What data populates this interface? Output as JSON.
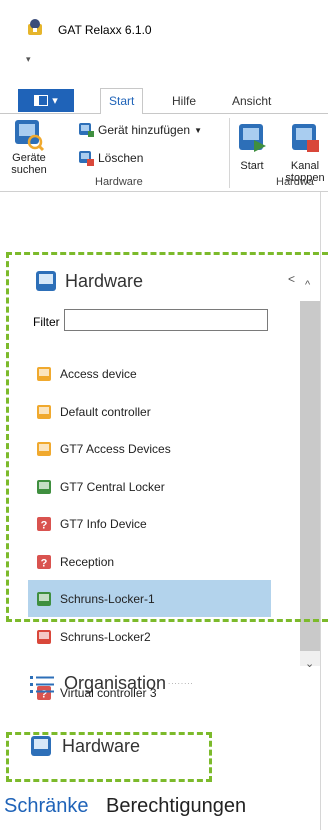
{
  "window": {
    "title": "GAT Relaxx 6.1.0",
    "qat_glyph": "▾"
  },
  "ribbon_tabs": {
    "file_menu_glyph": "▾",
    "tabs": [
      {
        "label": "Start",
        "active": true
      },
      {
        "label": "Hilfe",
        "active": false
      },
      {
        "label": "Ansicht",
        "active": false
      }
    ]
  },
  "ribbon": {
    "geraete_suchen": "Geräte suchen",
    "geraet_hinzufuegen": "Gerät hinzufügen",
    "loeschen": "Löschen",
    "group_hardware": "Hardware",
    "start": "Start",
    "kanal_stoppen": "Kanal stoppen",
    "group_hardware2": "Hardwa"
  },
  "panel": {
    "title": "Hardware",
    "filter_label": "Filter",
    "filter_value": "",
    "items": [
      {
        "label": "Access device",
        "icon": "device-orange-icon",
        "color": "#f0a92e",
        "selected": false
      },
      {
        "label": "Default controller",
        "icon": "device-orange-icon",
        "color": "#f0a92e",
        "selected": false
      },
      {
        "label": "GT7 Access Devices",
        "icon": "device-orange-icon",
        "color": "#f0a92e",
        "selected": false
      },
      {
        "label": "GT7 Central Locker",
        "icon": "device-green-icon",
        "color": "#3f8f3f",
        "selected": false
      },
      {
        "label": "GT7 Info Device",
        "icon": "device-unknown-icon",
        "color": "#d9534f",
        "selected": false
      },
      {
        "label": "Reception",
        "icon": "device-unknown-icon",
        "color": "#d9534f",
        "selected": false
      },
      {
        "label": "Schruns-Locker-1",
        "icon": "device-green-icon",
        "color": "#3f8f3f",
        "selected": true
      },
      {
        "label": "Schruns-Locker2",
        "icon": "device-red-icon",
        "color": "#d9473a",
        "selected": false
      },
      {
        "label": "Virtual controller 3",
        "icon": "device-unknown-icon",
        "color": "#d9534f",
        "selected": false
      }
    ],
    "dots": "........"
  },
  "nav": {
    "organisation": "Organisation",
    "hardware": "Hardware"
  },
  "bottom_tabs": {
    "active": "Schränke",
    "inactive": "Berechtigungen"
  },
  "colors": {
    "accent": "#1f63b8",
    "highlight": "#7cba2b",
    "selection": "#b3d3ec"
  }
}
